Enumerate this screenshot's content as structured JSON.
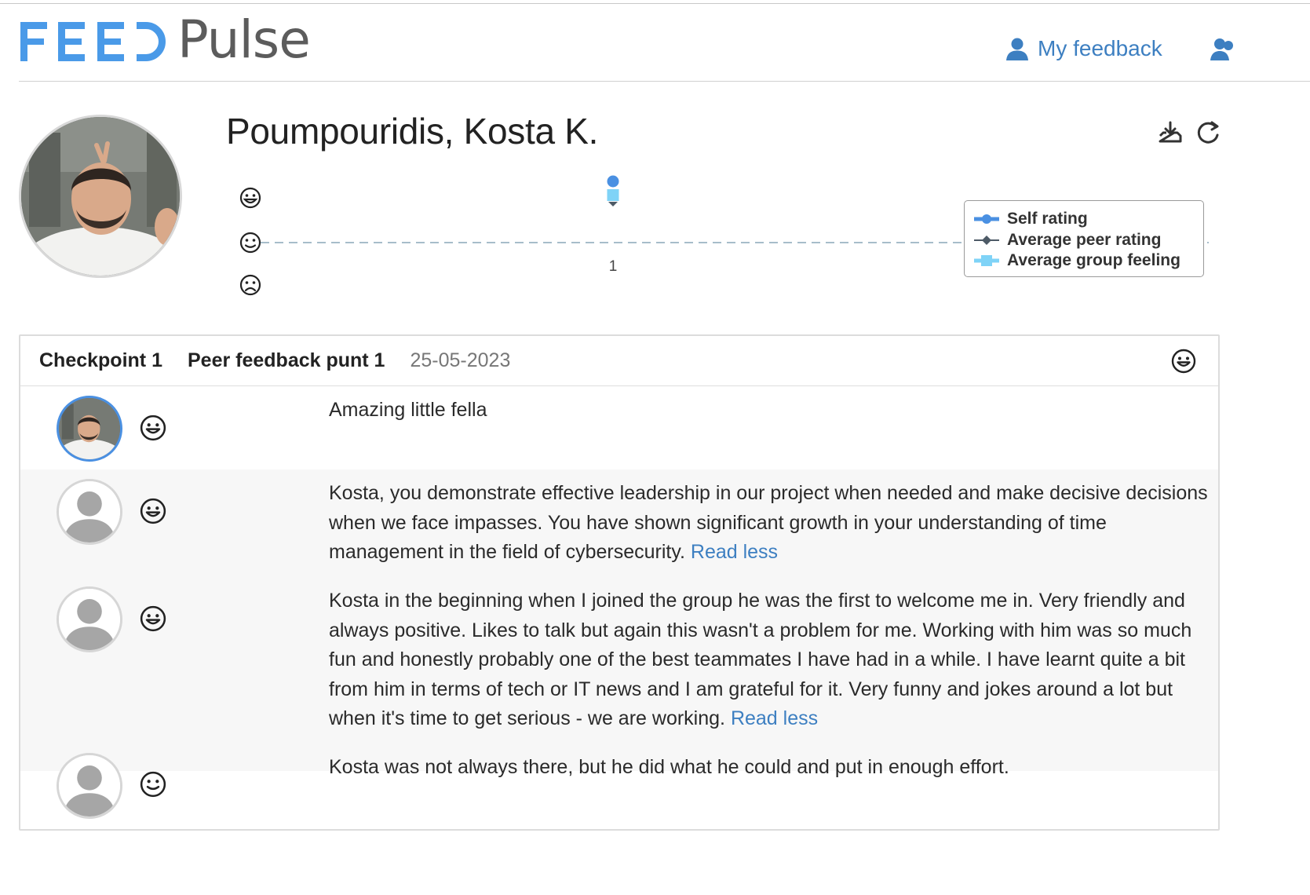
{
  "app": {
    "logo_left": "FEED",
    "logo_right": "Pulse"
  },
  "nav": {
    "my_feedback": "My feedback",
    "my_feedback_icon": "user-icon",
    "second_icon": "users-icon"
  },
  "profile": {
    "name": "Poumpouridis, Kosta K.",
    "download_icon": "download-icon",
    "refresh_icon": "refresh-icon"
  },
  "chart_data": {
    "type": "line",
    "x": [
      1
    ],
    "xtick_labels": [
      "1"
    ],
    "y_scale": [
      "happy",
      "neutral",
      "sad"
    ],
    "y_icons": [
      "happy-face-icon",
      "neutral-face-icon",
      "sad-face-icon"
    ],
    "series": [
      {
        "name": "Self rating",
        "values": [
          "happy"
        ],
        "color": "#4a90e2",
        "marker": "circle"
      },
      {
        "name": "Average peer rating",
        "values": [
          "happy"
        ],
        "color": "#4d5a66",
        "marker": "diamond"
      },
      {
        "name": "Average group feeling",
        "values": [
          "happy"
        ],
        "color": "#7fd3f7",
        "marker": "square"
      }
    ],
    "reference_line": "neutral",
    "legend": {
      "position": "right"
    }
  },
  "checkpoint": {
    "label": "Checkpoint 1",
    "title": "Peer feedback punt 1",
    "date": "25-05-2023",
    "feeling_icon": "happy-face-icon",
    "feedback": [
      {
        "author": "self",
        "rating_icon": "happy-face-icon",
        "text": "Amazing little fella",
        "link": ""
      },
      {
        "author": "anonymous",
        "rating_icon": "happy-face-icon",
        "text": "Kosta, you demonstrate effective leadership in our project when needed and make decisive decisions when we face impasses. You have shown significant growth in your understanding of time management in the field of cybersecurity.",
        "link": "Read less"
      },
      {
        "author": "anonymous",
        "rating_icon": "happy-face-icon",
        "text": "Kosta in the beginning when I joined the group he was the first to welcome me in. Very friendly and always positive. Likes to talk but again this wasn't a problem for me. Working with him was so much fun and honestly probably one of the best teammates I have had in a while. I have learnt quite a bit from him in terms of tech or IT news and I am grateful for it. Very funny and jokes around a lot but when it's time to get serious - we are working.",
        "link": "Read less"
      },
      {
        "author": "anonymous",
        "rating_icon": "neutral-face-icon",
        "text": "Kosta was not always there, but he did what he could and put in enough effort.",
        "link": ""
      }
    ]
  }
}
